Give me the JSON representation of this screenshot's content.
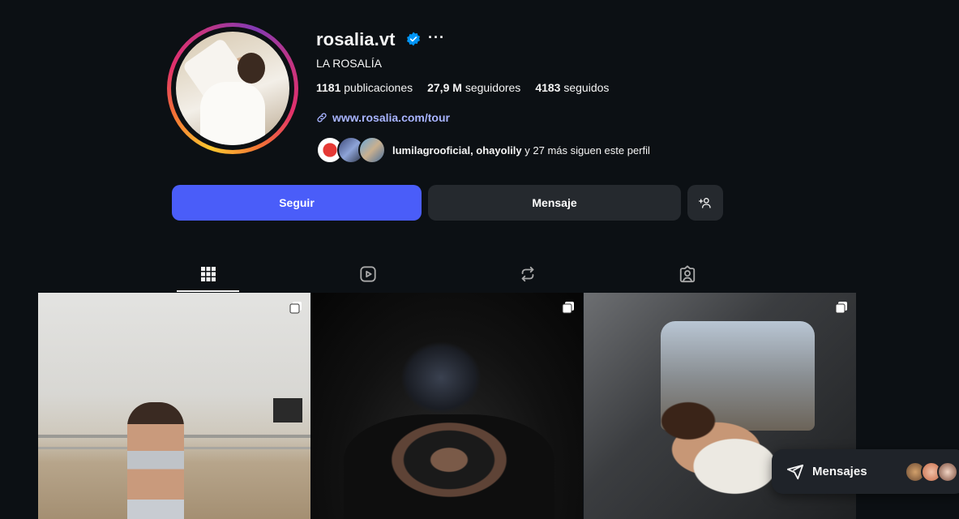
{
  "profile": {
    "username": "rosalia.vt",
    "full_name": "LA ROSALÍA",
    "more_label": "···",
    "stats": {
      "posts_count": "1181",
      "posts_label": "publicaciones",
      "followers_count": "27,9 M",
      "followers_label": "seguidores",
      "following_count": "4183",
      "following_label": "seguidos"
    },
    "website": "www.rosalia.com/tour",
    "followed_by": {
      "names": "lumilagrooficial, ohayolily",
      "rest": " y 27 más siguen este perfil"
    }
  },
  "actions": {
    "follow_label": "Seguir",
    "message_label": "Mensaje"
  },
  "tabs": [
    {
      "name": "posts",
      "icon": "grid-icon",
      "active": true
    },
    {
      "name": "reels",
      "icon": "reels-icon",
      "active": false
    },
    {
      "name": "reposts",
      "icon": "repost-icon",
      "active": false
    },
    {
      "name": "tagged",
      "icon": "tagged-icon",
      "active": false
    }
  ],
  "messages_panel": {
    "label": "Mensajes"
  },
  "colors": {
    "background": "#0c1014",
    "follow_button": "#4a5df9",
    "secondary_button": "#25292e",
    "link": "#a8b4ff",
    "verified": "#0095f6"
  }
}
